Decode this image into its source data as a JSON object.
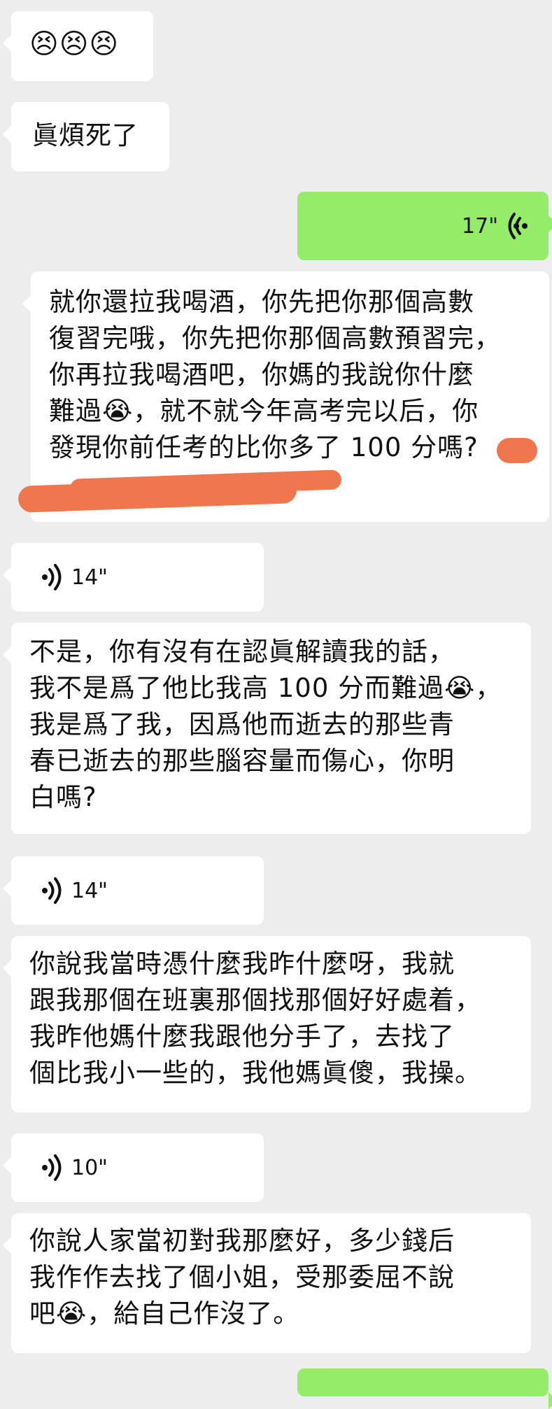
{
  "messages": [
    {
      "side": "left",
      "type": "emoji",
      "text": "😣😣😣"
    },
    {
      "side": "left",
      "type": "text",
      "text": "眞煩死了"
    },
    {
      "side": "right",
      "type": "voice",
      "duration": "17\""
    },
    {
      "side": "left",
      "type": "text",
      "text": "就你還拉我喝酒，你先把你那個高數\n復習完哦，你先把你那個高數預習完，\n你再拉我喝酒吧，你媽的我說你什麼\n難過😭，就不就今年高考完以后，你\n發現你前任考的比你多了 100 分嗎?"
    },
    {
      "side": "left",
      "type": "voice",
      "duration": "14\""
    },
    {
      "side": "left",
      "type": "text",
      "text": "不是，你有沒有在認眞解讀我的話，\n我不是爲了他比我高 100 分而難過😭，\n我是爲了我，因爲他而逝去的那些青\n春已逝去的那些腦容量而傷心，你明\n白嗎?"
    },
    {
      "side": "left",
      "type": "voice",
      "duration": "14\""
    },
    {
      "side": "left",
      "type": "text",
      "text": "你說我當時憑什麼我昨什麼呀，我就\n跟我那個在班裏那個找那個好好處着，\n我昨他媽什麼我跟他分手了，去找了\n個比我小一些的，我他媽眞傻，我操。"
    },
    {
      "side": "left",
      "type": "voice",
      "duration": "10\""
    },
    {
      "side": "left",
      "type": "text",
      "text": "你說人家當初對我那麼好，多少錢后\n我作作去找了個小姐，受那委屈不說\n吧😭，給自己作沒了。"
    }
  ]
}
